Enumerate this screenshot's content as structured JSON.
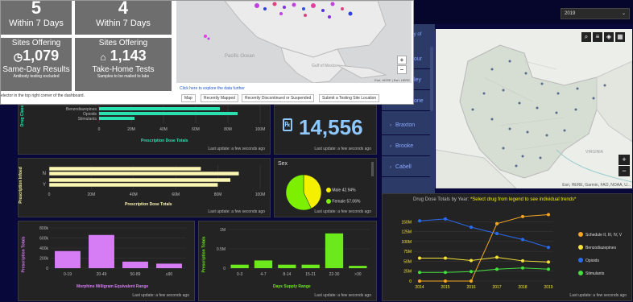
{
  "overlay": {
    "tiles_top": [
      {
        "number": "5",
        "label": "Within 7 Days"
      },
      {
        "number": "4",
        "label": "Within 7 Days"
      }
    ],
    "tiles_bottom": [
      {
        "title": "Sites Offering",
        "number": "1,079",
        "label": "Same-Day Results",
        "note": "Antibody testing excluded",
        "icon": "clock-icon"
      },
      {
        "title": "Sites Offering",
        "number": "1,143",
        "label": "Take-Home Tests",
        "note": "Samples to be mailed to labs",
        "icon": "home-icon"
      }
    ],
    "hint": "elector in the top right corner of the dashboard.",
    "map_labels": {
      "ocean": "Pacific Ocean",
      "gulf": "Gulf of Mexico"
    },
    "attribution": "Esri, HERE | Esri, HERE",
    "explore_link": "Click here to explore the data further",
    "tabs": [
      "Map",
      "Recently Mapped",
      "Recently Discontinued or Suspended",
      "Submit a Testing Site Location"
    ],
    "zoom_plus": "+",
    "zoom_minus": "−"
  },
  "year_select": {
    "value": "2019"
  },
  "sidebar": {
    "header": "ty of",
    "items": [
      {
        "label": "bour"
      },
      {
        "label": "ley"
      },
      {
        "label": "one"
      },
      {
        "label": "Braxton"
      },
      {
        "label": "Brooke"
      },
      {
        "label": "Cabell"
      }
    ]
  },
  "wv_map": {
    "attribution": "Esri, HERE, Garmin, FAO, NOAA, U...",
    "labels": {
      "va": "VIRGINIA"
    },
    "zoom_plus": "+",
    "zoom_minus": "−"
  },
  "panels": {
    "top_bar": {
      "ylabel": "Drug Class",
      "categories": [
        "Benzodiazepines",
        "Opioids",
        "Stimulants"
      ],
      "ticks": [
        "0",
        "20M",
        "40M",
        "60M",
        "80M",
        "100M"
      ],
      "xlabel": "Prescription Dose Totals",
      "update": "Last update: a few seconds ago",
      "color": "#28e0b0"
    },
    "kpi": {
      "value": "14,556",
      "update": "Last update: a few seconds ago",
      "color": "#8ec8ff",
      "icon": "prescription-icon"
    },
    "second_bar": {
      "ylabel": "Prescription Infoed",
      "categories": [
        "N",
        "Y"
      ],
      "ticks": [
        "0",
        "20M",
        "40M",
        "60M",
        "80M",
        "100M"
      ],
      "xlabel": "Prescription Dose Totals",
      "update": "Last update: a few seconds ago",
      "color": "#fbf6b1"
    },
    "sex": {
      "title": "Sex",
      "legend": [
        {
          "label": "Male",
          "value": "42.94%",
          "color": "#f5f000"
        },
        {
          "label": "Female",
          "value": "57.06%",
          "color": "#7cf000"
        }
      ],
      "update": "Last update: a few seconds ago"
    },
    "line": {
      "title": "Drug Dose Totals by Year:",
      "subtitle": "*Select drug from legend to see individual trends*",
      "update": "Last update: a few seconds ago"
    },
    "mme": {
      "ylabel": "Prescription Totals",
      "xlabel": "Morphine Milligram Equivalent Range",
      "update": "Last update: a few seconds ago",
      "color": "#d67cf4"
    },
    "days": {
      "ylabel": "Prescription Totals",
      "xlabel": "Days Supply Range",
      "update": "Last update: a few seconds ago",
      "color": "#6be91c"
    }
  },
  "chart_data": [
    {
      "type": "bar",
      "orientation": "horizontal",
      "categories": [
        "Benzodiazepines",
        "Opioids",
        "Stimulants"
      ],
      "values": [
        75,
        86,
        22
      ],
      "xlabel": "Prescription Dose Totals",
      "ylabel": "Drug Class",
      "xlim": [
        0,
        100
      ]
    },
    {
      "type": "bar",
      "orientation": "horizontal",
      "categories": [
        "N",
        "Y"
      ],
      "series": [
        {
          "values": [
            72,
            86
          ]
        },
        {
          "values": [
            90,
            80
          ]
        }
      ],
      "xlabel": "Prescription Dose Totals",
      "ylabel": "Prescription Infoed",
      "xlim": [
        0,
        100
      ]
    },
    {
      "type": "pie",
      "categories": [
        "Male",
        "Female"
      ],
      "values": [
        42.94,
        57.06
      ],
      "title": "Sex"
    },
    {
      "type": "line",
      "title": "Drug Dose Totals by Year:",
      "x": [
        "2014",
        "2015",
        "2016",
        "2017",
        "2018",
        "2019"
      ],
      "yticks": [
        "0",
        "25M",
        "50M",
        "75M",
        "100M",
        "125M",
        "150M"
      ],
      "ylim": [
        0,
        175
      ],
      "series": [
        {
          "name": "Schedule II, III, IV, V",
          "color": "#f5a623",
          "values": [
            0,
            0,
            0,
            145,
            163,
            168
          ]
        },
        {
          "name": "Benzodiazepines",
          "color": "#f5e23a",
          "values": [
            58,
            58,
            52,
            60,
            51,
            48
          ]
        },
        {
          "name": "Opioids",
          "color": "#2a6bf2",
          "values": [
            152,
            157,
            136,
            120,
            105,
            85
          ]
        },
        {
          "name": "Stimulants",
          "color": "#44e040",
          "values": [
            22,
            22,
            24,
            30,
            33,
            30
          ]
        }
      ],
      "legend": "right"
    },
    {
      "type": "bar",
      "categories": [
        "0-19",
        "20-49",
        "50-89",
        "≥90"
      ],
      "values": [
        340,
        660,
        130,
        90
      ],
      "yticks": [
        "0",
        "200k",
        "400k",
        "600k",
        "800k"
      ],
      "ylim": [
        0,
        800
      ],
      "xlabel": "Morphine Milligram Equivalent Range",
      "ylabel": "Prescription Totals"
    },
    {
      "type": "bar",
      "categories": [
        "0-3",
        "4-7",
        "8-14",
        "15-21",
        "22-30",
        ">30"
      ],
      "values": [
        90,
        200,
        90,
        90,
        900,
        60
      ],
      "yticks": [
        "0",
        "0.5M",
        "1M"
      ],
      "ylim": [
        0,
        1000
      ],
      "xlabel": "Days Supply Range",
      "ylabel": "Prescription Totals"
    }
  ]
}
